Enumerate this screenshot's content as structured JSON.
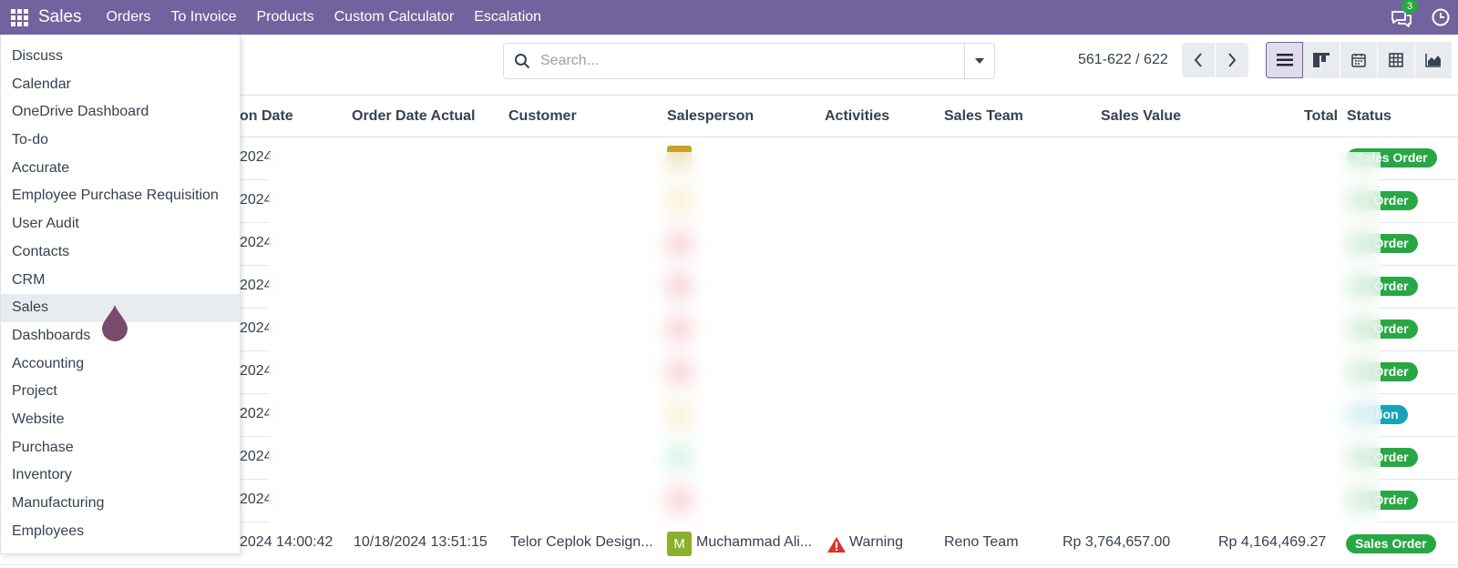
{
  "navbar": {
    "brand": "Sales",
    "menu": [
      "Orders",
      "To Invoice",
      "Products",
      "Custom Calculator",
      "Escalation"
    ],
    "chat_badge": "3",
    "color": "#71639e"
  },
  "search": {
    "placeholder": "Search..."
  },
  "pager": {
    "value": "561-622 / 622"
  },
  "views": [
    "list",
    "kanban",
    "calendar",
    "pivot",
    "graph"
  ],
  "table": {
    "columns": {
      "creation_date": "on Date",
      "order_date_actual": "Order Date Actual",
      "customer": "Customer",
      "salesperson": "Salesperson",
      "activities": "Activities",
      "sales_team": "Sales Team",
      "sales_value": "Sales Value",
      "total": "Total",
      "status": "Status"
    },
    "rows": [
      {
        "date": "2024",
        "status": "Sales Order",
        "status_visible": "Sales Order",
        "avatar_color": "#c9a227"
      },
      {
        "date": "2024",
        "status": "Sales Order",
        "status_visible": "es Order",
        "avatar_color": "#e6c25a"
      },
      {
        "date": "2024",
        "status": "Sales Order",
        "status_visible": "es Order",
        "avatar_color": "#e05a6a"
      },
      {
        "date": "2024",
        "status": "Sales Order",
        "status_visible": "es Order",
        "avatar_color": "#e05a6a"
      },
      {
        "date": "2024",
        "status": "Sales Order",
        "status_visible": "es Order",
        "avatar_color": "#e05a6a"
      },
      {
        "date": "2024",
        "status": "Sales Order",
        "status_visible": "es Order",
        "avatar_color": "#e05a6a"
      },
      {
        "date": "2024",
        "status": "Quotation",
        "status_visible": "otation",
        "avatar_color": "#e6c25a"
      },
      {
        "date": "2024",
        "status": "Sales Order",
        "status_visible": "es Order",
        "avatar_color": "#5fd3a8"
      },
      {
        "date": "2024",
        "status": "Sales Order",
        "status_visible": "es Order",
        "avatar_color": "#e05a6a"
      },
      {
        "date": "2024 14:00:42",
        "order_date_actual": "10/18/2024 13:51:15",
        "customer": "Telor Ceplok Design...",
        "salesperson_initial": "M",
        "salesperson": "Muchammad Ali...",
        "activity": "Warning",
        "sales_team": "Reno Team",
        "sales_value": "Rp 3,764,657.00",
        "total": "Rp 4,164,469.27",
        "status": "Sales Order",
        "status_visible": "Sales Order",
        "avatar_color": "#8bb02a"
      }
    ]
  },
  "app_menu": {
    "items": [
      "Discuss",
      "Calendar",
      "OneDrive Dashboard",
      "To-do",
      "Accurate",
      "Employee Purchase Requisition",
      "User Audit",
      "Contacts",
      "CRM",
      "Sales",
      "Dashboards",
      "Accounting",
      "Project",
      "Website",
      "Purchase",
      "Inventory",
      "Manufacturing",
      "Employees"
    ],
    "active": "Sales"
  }
}
